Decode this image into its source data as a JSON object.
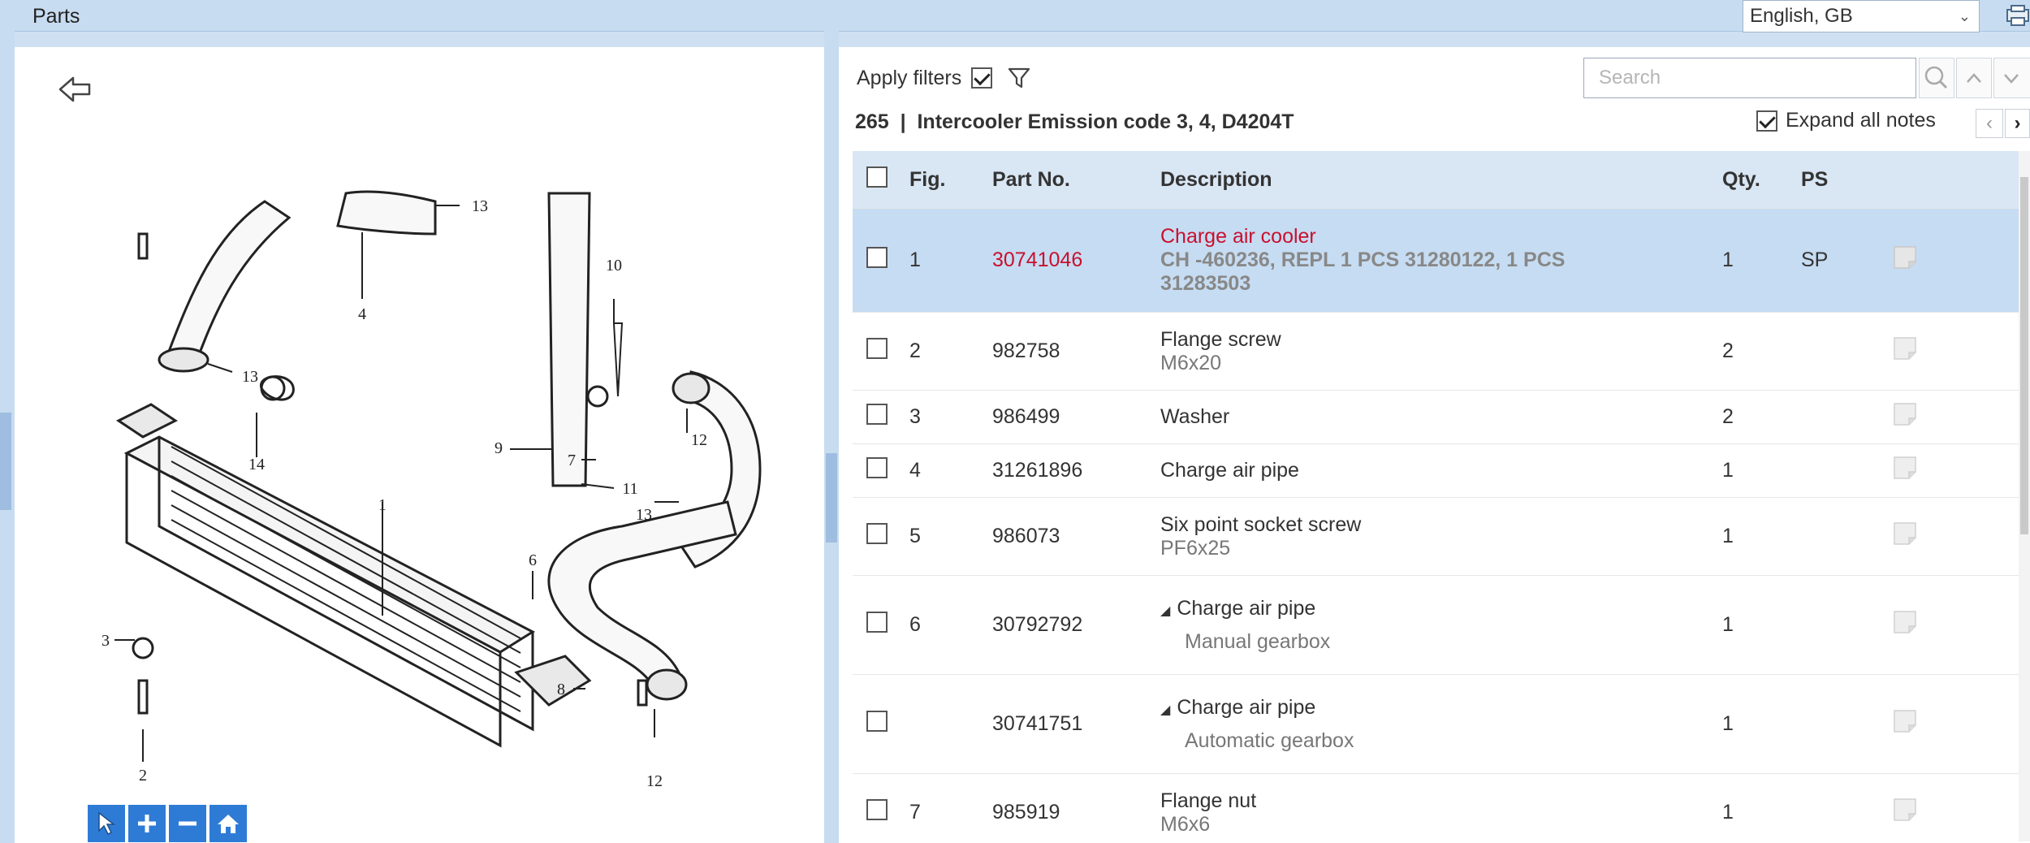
{
  "window": {
    "title": "Parts"
  },
  "language": {
    "selected": "English, GB"
  },
  "filters": {
    "apply_label": "Apply filters",
    "apply_checked": true
  },
  "search": {
    "placeholder": "Search"
  },
  "group": {
    "heading": "265  |  Intercooler Emission code 3, 4, D4204T"
  },
  "expand_notes": {
    "label": "Expand all notes",
    "checked": true
  },
  "table": {
    "headers": {
      "fig": "Fig.",
      "part": "Part No.",
      "desc": "Description",
      "qty": "Qty.",
      "ps": "PS"
    },
    "rows": [
      {
        "fig": "1",
        "part": "30741046",
        "desc": "Charge air cooler",
        "sub": "CH -460236, REPL 1 PCS 31280122, 1 PCS 31283503",
        "qty": "1",
        "ps": "SP"
      },
      {
        "fig": "2",
        "part": "982758",
        "desc": "Flange screw",
        "sub": "M6x20",
        "qty": "2",
        "ps": ""
      },
      {
        "fig": "3",
        "part": "986499",
        "desc": "Washer",
        "sub": "",
        "qty": "2",
        "ps": ""
      },
      {
        "fig": "4",
        "part": "31261896",
        "desc": "Charge air pipe",
        "sub": "",
        "qty": "1",
        "ps": ""
      },
      {
        "fig": "5",
        "part": "986073",
        "desc": "Six point socket screw",
        "sub": "PF6x25",
        "qty": "1",
        "ps": ""
      },
      {
        "fig": "6",
        "part": "30792792",
        "desc": "Charge air pipe",
        "sub": "Manual gearbox",
        "qty": "1",
        "ps": ""
      },
      {
        "fig": "",
        "part": "30741751",
        "desc": "Charge air pipe",
        "sub": "Automatic gearbox",
        "qty": "1",
        "ps": ""
      },
      {
        "fig": "7",
        "part": "985919",
        "desc": "Flange nut",
        "sub": "M6x6",
        "qty": "1",
        "ps": ""
      }
    ]
  },
  "diagram_labels": [
    "13",
    "4",
    "10",
    "13",
    "12",
    "14",
    "9",
    "7",
    "11",
    "1",
    "13",
    "6",
    "3",
    "8",
    "2",
    "12"
  ],
  "colors": {
    "accent": "#c8102e",
    "selected_row": "#c6dcf2",
    "header_bg": "#d9e6f4",
    "toolbar_blue": "#2e7bd6"
  }
}
